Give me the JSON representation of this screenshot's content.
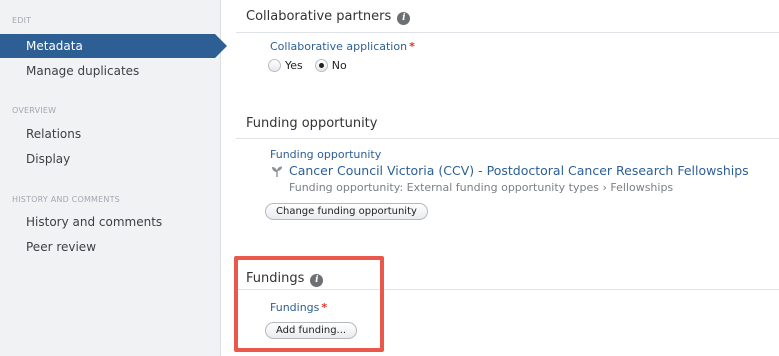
{
  "sidebar": {
    "edit_label": "EDIT",
    "overview_label": "OVERVIEW",
    "history_label": "HISTORY AND COMMENTS",
    "items": [
      {
        "label": "Metadata"
      },
      {
        "label": "Manage duplicates"
      },
      {
        "label": "Relations"
      },
      {
        "label": "Display"
      },
      {
        "label": "History and comments"
      },
      {
        "label": "Peer review"
      }
    ]
  },
  "main": {
    "collab": {
      "title": "Collaborative partners",
      "field_label": "Collaborative application",
      "required_mark": "*",
      "options": [
        {
          "label": "Yes",
          "checked": false
        },
        {
          "label": "No",
          "checked": true
        }
      ]
    },
    "funding_opportunity": {
      "title": "Funding opportunity",
      "field_label": "Funding opportunity",
      "link_text": "Cancer Council Victoria (CCV) - Postdoctoral Cancer Research Fellowships",
      "subtext": "Funding opportunity: External funding opportunity types › Fellowships",
      "change_button": "Change funding opportunity"
    },
    "fundings": {
      "title": "Fundings",
      "field_label": "Fundings",
      "required_mark": "*",
      "add_button": "Add funding..."
    }
  },
  "colors": {
    "accent": "#2d5f95",
    "required": "#e0342c",
    "highlight": "#e9584a",
    "sidebar_bg": "#f1f2f4"
  },
  "icons": {
    "info": "info-icon",
    "funding": "sprout-icon"
  }
}
